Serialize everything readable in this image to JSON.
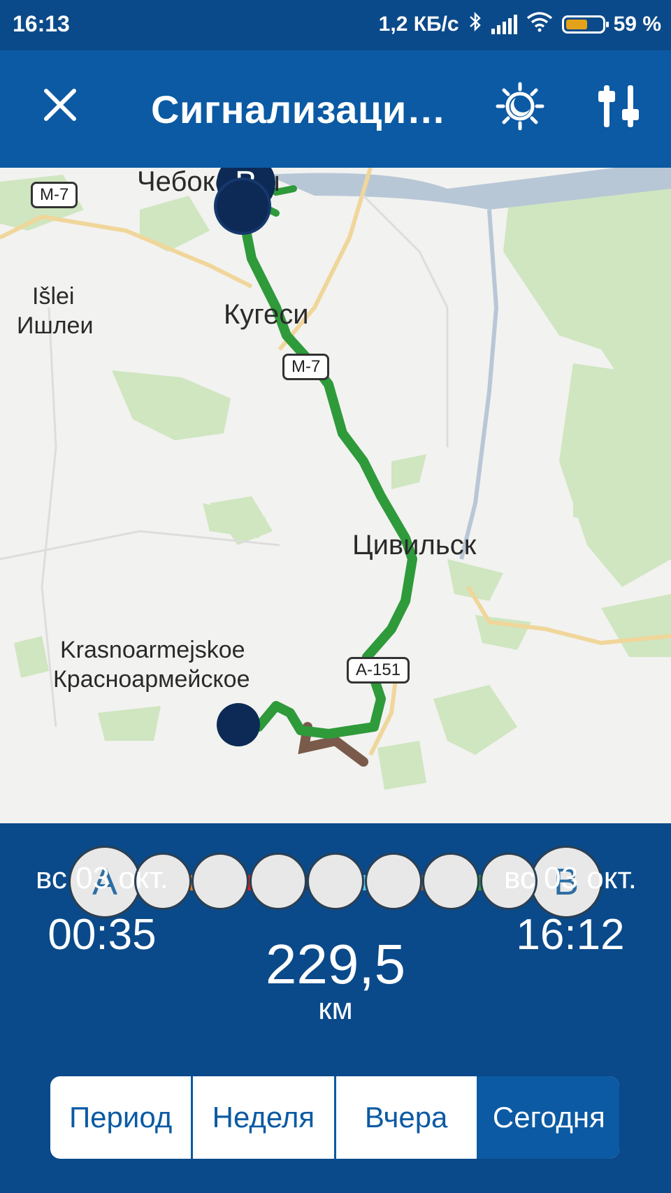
{
  "status_bar": {
    "time": "16:13",
    "network_speed": "1,2 КБ/с",
    "battery_percent": "59 %",
    "battery_level": 0.59,
    "icons": [
      "bluetooth-icon",
      "signal-icon",
      "wifi-icon",
      "battery-icon"
    ]
  },
  "header": {
    "title": "Сигнализаци…",
    "icons": [
      "close-icon",
      "day-night-icon",
      "filter-sliders-icon"
    ],
    "accent_color": "#0b5aa3"
  },
  "map": {
    "places": {
      "cheboksary": "Чебоксары",
      "kugesi": "Кугеси",
      "islei_latin": "Išlei",
      "islei_cyr": "Ишлеи",
      "tsivilsk": "Цивильск",
      "krasno_latin": "Krasnoarmejskoe",
      "krasno_cyr": "Красноармейское"
    },
    "road_shields": {
      "m7_top": "М-7",
      "m7_mid": "М-7",
      "a151": "А-151"
    },
    "marker_b_label": "B",
    "route_color": "#2e9a3a",
    "fab_icon": "route-points-icon"
  },
  "trip": {
    "start_label": "A",
    "end_label": "B",
    "segment_colors": [
      "#2a8fd6",
      "#f07f1a",
      "#d61f1f",
      "#1b3c66",
      "#4fc8f0",
      "#7a5a4a",
      "#2e9a3a"
    ],
    "start_date": "вс 03 окт.",
    "start_time": "00:35",
    "end_date": "вс 03 окт.",
    "end_time": "16:12",
    "distance": "229,5",
    "distance_unit": "км"
  },
  "period_selector": {
    "options": [
      "Период",
      "Неделя",
      "Вчера",
      "Сегодня"
    ],
    "active": "Сегодня"
  }
}
